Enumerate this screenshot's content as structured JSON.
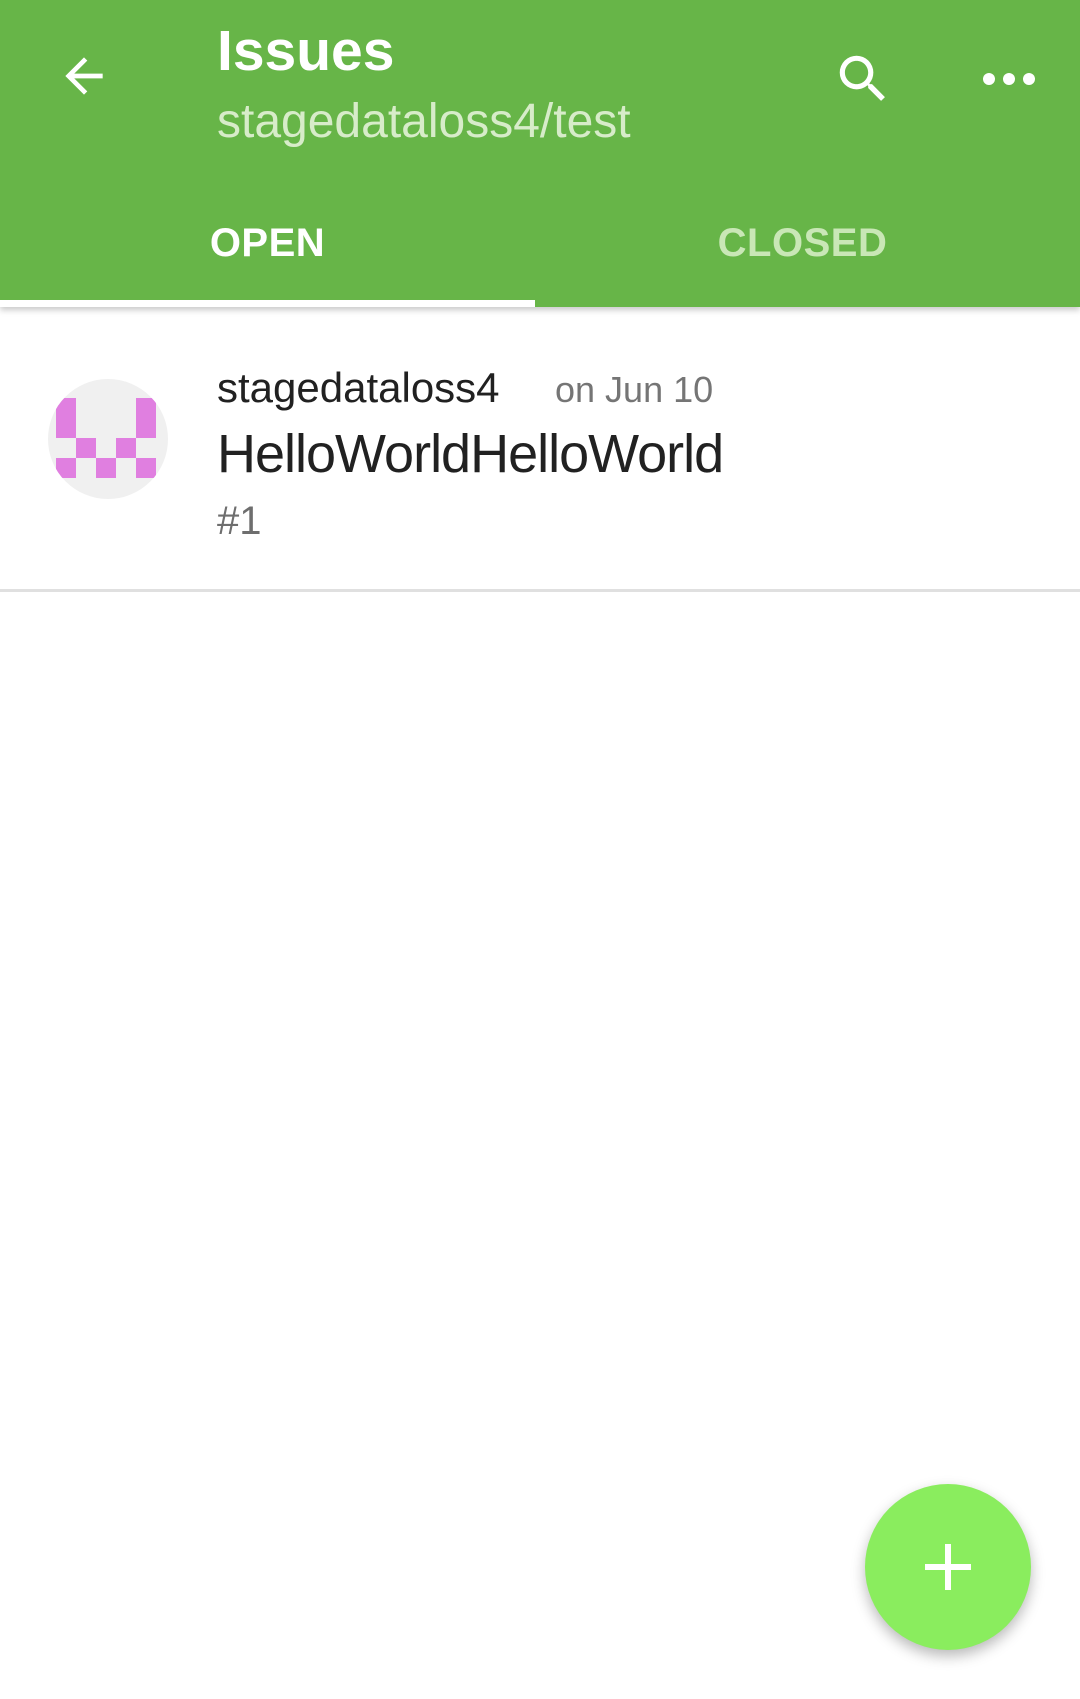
{
  "appbar": {
    "title": "Issues",
    "subtitle": "stagedataloss4/test",
    "back_icon": "arrow-back-icon",
    "search_icon": "search-icon",
    "more_icon": "more-options-icon",
    "background_color": "#67b548"
  },
  "tabs": [
    {
      "label": "OPEN",
      "selected": true
    },
    {
      "label": "CLOSED",
      "selected": false
    }
  ],
  "issues": [
    {
      "author": "stagedataloss4",
      "date": "on Jun 10",
      "title": "HelloWorldHelloWorld",
      "number": "#1",
      "avatar_color": "#e07fe0"
    }
  ],
  "fab": {
    "icon": "plus-icon",
    "color": "#8aed5e"
  }
}
